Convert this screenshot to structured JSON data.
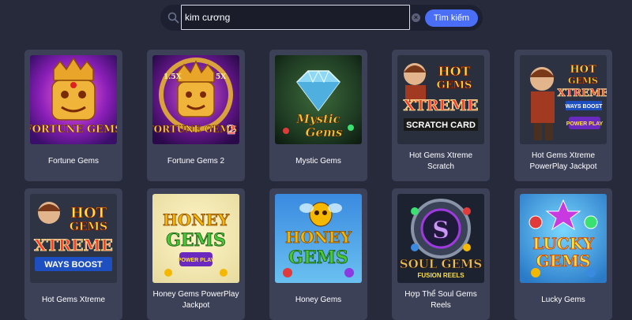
{
  "search": {
    "value": "kim cương",
    "button_label": "Tìm kiếm"
  },
  "games": [
    {
      "title": "Fortune Gems",
      "icon": "fortune-gems-thumbnail"
    },
    {
      "title": "Fortune Gems 2",
      "icon": "fortune-gems-2-thumbnail"
    },
    {
      "title": "Mystic Gems",
      "icon": "mystic-gems-thumbnail"
    },
    {
      "title": "Hot Gems Xtreme Scratch",
      "icon": "hot-gems-xtreme-scratch-thumbnail"
    },
    {
      "title": "Hot Gems Xtreme PowerPlay Jackpot",
      "icon": "hot-gems-xtreme-powerplay-thumbnail"
    },
    {
      "title": "Hot Gems Xtreme",
      "icon": "hot-gems-xtreme-thumbnail"
    },
    {
      "title": "Honey Gems PowerPlay Jackpot",
      "icon": "honey-gems-powerplay-thumbnail"
    },
    {
      "title": "Honey Gems",
      "icon": "honey-gems-thumbnail"
    },
    {
      "title": "Hợp Thể Soul Gems Reels",
      "icon": "soul-gems-thumbnail"
    },
    {
      "title": "Lucky Gems",
      "icon": "lucky-gems-thumbnail"
    }
  ],
  "colors": {
    "background": "#272a3b",
    "card": "#3c4158",
    "accent": "#4a6ef5"
  }
}
